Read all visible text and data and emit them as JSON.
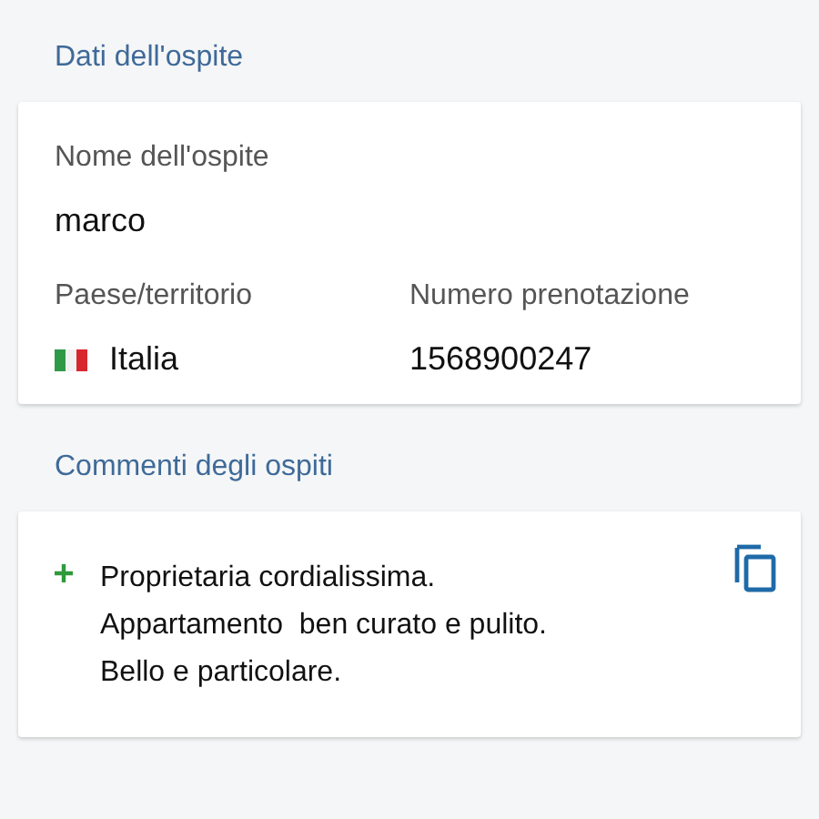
{
  "guest_section": {
    "title": "Dati dell'ospite",
    "fields": [
      {
        "label": "Nome dell'ospite",
        "value": "marco"
      },
      {
        "label": "Paese/territorio",
        "value": "Italia",
        "flag": true
      },
      {
        "label": "Numero prenotazione",
        "value": "1568900247"
      }
    ]
  },
  "comments_section": {
    "title": "Commenti degli ospiti",
    "comments": [
      {
        "kind": "positive",
        "lines": [
          "Proprietaria cordialissima.",
          "Appartamento  ben curato e pulito.",
          "Bello e particolare."
        ]
      }
    ]
  }
}
